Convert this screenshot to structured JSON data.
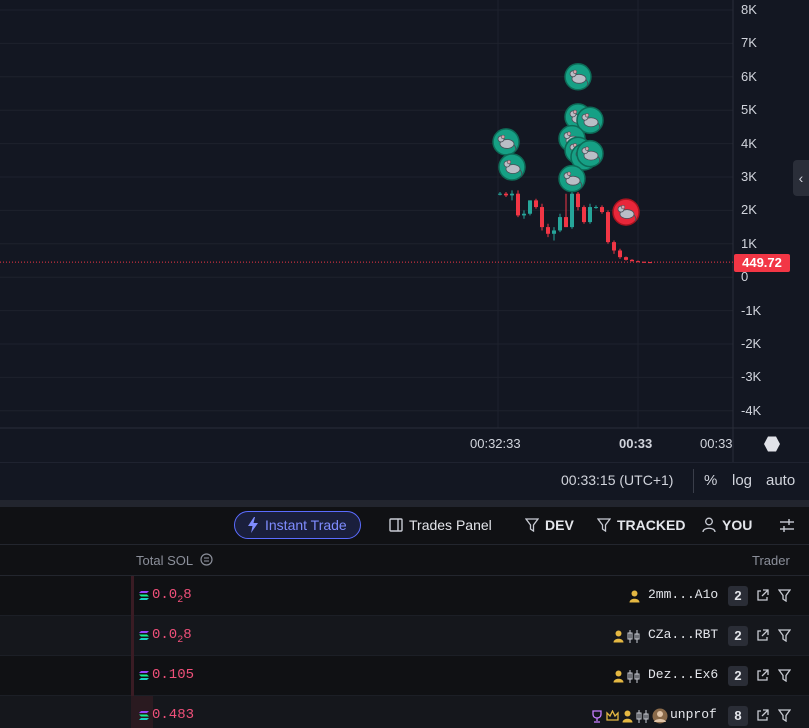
{
  "chart": {
    "y_ticks": [
      "8K",
      "7K",
      "6K",
      "5K",
      "4K",
      "3K",
      "2K",
      "1K",
      "0",
      "-1K",
      "-2K",
      "-3K",
      "-4K"
    ],
    "x_ticks": [
      {
        "label": "00:32:33",
        "bold": false
      },
      {
        "label": "00:33",
        "bold": true
      },
      {
        "label": "00:33",
        "bold": false
      }
    ],
    "current_price": "449.72",
    "colors": {
      "up": "#26a69a",
      "down": "#f23645",
      "buy_marker": "#16a085",
      "sell_marker": "#e8273a"
    }
  },
  "chart_data": {
    "type": "candlestick",
    "ylim": [
      -4500,
      8300
    ],
    "yticks": [
      8000,
      7000,
      6000,
      5000,
      4000,
      3000,
      2000,
      1000,
      0,
      -1000,
      -2000,
      -3000,
      -4000
    ],
    "candles": [
      {
        "o": 2500,
        "h": 2550,
        "l": 2450,
        "c": 2500
      },
      {
        "o": 2500,
        "h": 2550,
        "l": 2400,
        "c": 2450
      },
      {
        "o": 2450,
        "h": 2600,
        "l": 2300,
        "c": 2500
      },
      {
        "o": 2500,
        "h": 2600,
        "l": 1800,
        "c": 1850
      },
      {
        "o": 1850,
        "h": 2000,
        "l": 1750,
        "c": 1900
      },
      {
        "o": 1900,
        "h": 2300,
        "l": 1850,
        "c": 2300
      },
      {
        "o": 2300,
        "h": 2350,
        "l": 2050,
        "c": 2100
      },
      {
        "o": 2100,
        "h": 2200,
        "l": 1400,
        "c": 1500
      },
      {
        "o": 1500,
        "h": 1600,
        "l": 1200,
        "c": 1300
      },
      {
        "o": 1300,
        "h": 1500,
        "l": 1100,
        "c": 1400
      },
      {
        "o": 1400,
        "h": 1900,
        "l": 1350,
        "c": 1800
      },
      {
        "o": 1800,
        "h": 2500,
        "l": 1500,
        "c": 1500
      },
      {
        "o": 1500,
        "h": 2600,
        "l": 1450,
        "c": 2500
      },
      {
        "o": 2500,
        "h": 2550,
        "l": 2000,
        "c": 2100
      },
      {
        "o": 2100,
        "h": 2150,
        "l": 1600,
        "c": 1650
      },
      {
        "o": 1650,
        "h": 2200,
        "l": 1600,
        "c": 2100
      },
      {
        "o": 2100,
        "h": 2150,
        "l": 2050,
        "c": 2100
      },
      {
        "o": 2100,
        "h": 2150,
        "l": 1900,
        "c": 1950
      },
      {
        "o": 1950,
        "h": 2000,
        "l": 1000,
        "c": 1050
      },
      {
        "o": 1050,
        "h": 1100,
        "l": 700,
        "c": 800
      },
      {
        "o": 800,
        "h": 850,
        "l": 550,
        "c": 600
      },
      {
        "o": 600,
        "h": 620,
        "l": 500,
        "c": 520
      },
      {
        "o": 520,
        "h": 540,
        "l": 470,
        "c": 480
      },
      {
        "o": 480,
        "h": 500,
        "l": 450,
        "c": 460
      },
      {
        "o": 460,
        "h": 470,
        "l": 449,
        "c": 452
      },
      {
        "o": 452,
        "h": 455,
        "l": 449,
        "c": 449.72
      }
    ],
    "markers": [
      {
        "side": "buy",
        "candle": 12,
        "y": 6000
      },
      {
        "side": "buy",
        "candle": 12,
        "y": 4800
      },
      {
        "side": "buy",
        "candle": 14,
        "y": 4700
      },
      {
        "side": "buy",
        "candle": 0,
        "y": 4050
      },
      {
        "side": "buy",
        "candle": 11,
        "y": 4150
      },
      {
        "side": "buy",
        "candle": 12,
        "y": 3800
      },
      {
        "side": "buy",
        "candle": 13,
        "y": 3600
      },
      {
        "side": "buy",
        "candle": 14,
        "y": 3700
      },
      {
        "side": "buy",
        "candle": 1,
        "y": 3300
      },
      {
        "side": "buy",
        "candle": 11,
        "y": 2950
      },
      {
        "side": "sell",
        "candle": 21,
        "y": 1950
      }
    ]
  },
  "footer": {
    "time": "00:33:15 (UTC+1)",
    "percent": "%",
    "log": "log",
    "auto": "auto"
  },
  "toolbar": {
    "instant_trade": "Instant Trade",
    "trades_panel": "Trades Panel",
    "dev": "DEV",
    "tracked": "TRACKED",
    "you": "YOU"
  },
  "table": {
    "header_total": "Total SOL",
    "header_trader": "Trader",
    "rows": [
      {
        "amount_html": "0.0",
        "sub": "2",
        "tail": "8",
        "trader": "2mm...A1o",
        "badges": [
          "user"
        ],
        "count": "2"
      },
      {
        "amount_html": "0.0",
        "sub": "2",
        "tail": "8",
        "trader": "CZa...RBT",
        "badges": [
          "user",
          "candles"
        ],
        "count": "2"
      },
      {
        "amount_html": "0.105",
        "sub": "",
        "tail": "",
        "trader": "Dez...Ex6",
        "badges": [
          "user",
          "candles"
        ],
        "count": "2"
      },
      {
        "amount_html": "0.483",
        "sub": "",
        "tail": "",
        "trader": "unprof",
        "badges": [
          "trophy",
          "crown",
          "user",
          "candles",
          "avatar"
        ],
        "count": "8"
      }
    ]
  }
}
